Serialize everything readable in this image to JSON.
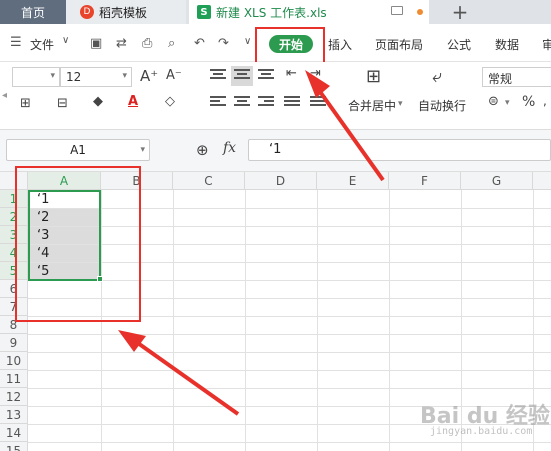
{
  "tabs": {
    "home": "首页",
    "docer": "稻壳模板",
    "file": "新建 XLS 工作表.xls",
    "add": "+"
  },
  "menu": {
    "file": "文件",
    "items": [
      "开始",
      "插入",
      "页面布局",
      "公式",
      "数据",
      "审"
    ]
  },
  "ribbon": {
    "font_size": "12",
    "number_format": "常规",
    "merge_label": "合并居中",
    "wrap_label": "自动换行",
    "percent": "%"
  },
  "formula_bar": {
    "cell_ref": "A1",
    "fx": "fx",
    "content": "‘1"
  },
  "grid": {
    "columns": [
      "A",
      "B",
      "C",
      "D",
      "E",
      "F",
      "G"
    ],
    "rows": [
      "1",
      "2",
      "3",
      "4",
      "5",
      "6",
      "7",
      "8",
      "9",
      "10",
      "11",
      "12",
      "13",
      "14",
      "15"
    ],
    "cells_a": [
      "‘1",
      "‘2",
      "‘3",
      "‘4",
      "‘5"
    ]
  },
  "watermark": {
    "text": "Bai du 经验",
    "sub": "jingyan.baidu.com"
  },
  "colors": {
    "accent_green": "#2d9b4f",
    "annotation_red": "#e8312a"
  }
}
